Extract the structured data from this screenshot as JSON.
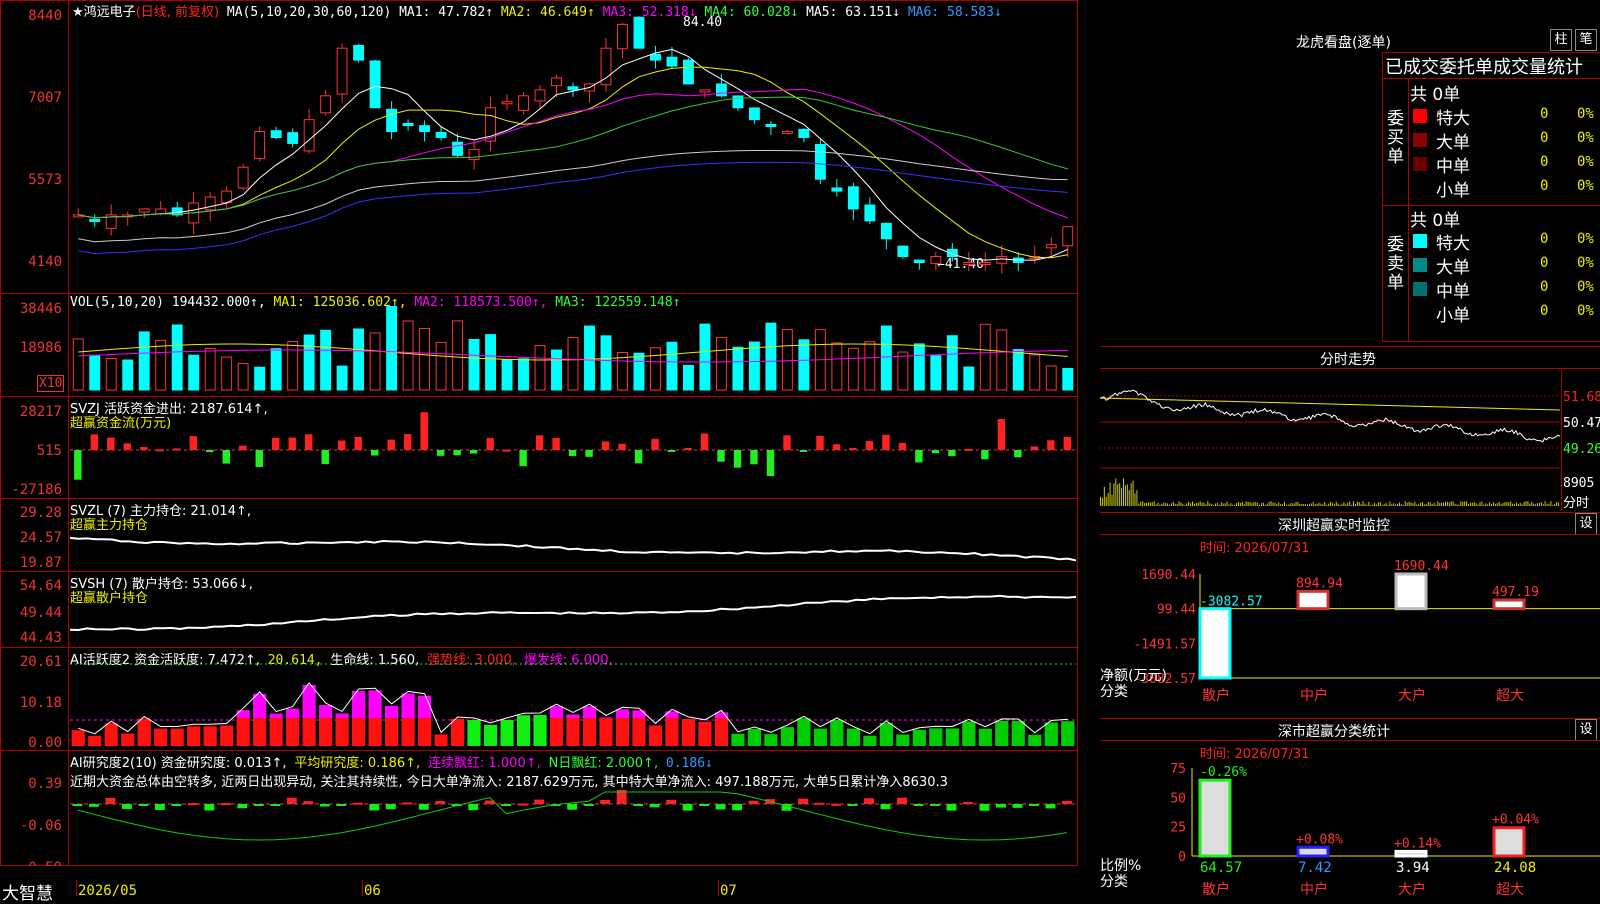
{
  "header": {
    "stock": "★鸿远电子",
    "mode": "(日线, 前复权)",
    "ma_label": "MA(5,10,20,30,60,120)",
    "ma1": "MA1: 47.782↑",
    "ma2": "MA2: 46.649↑",
    "ma3": "MA3: 52.318↓",
    "ma4": "MA4: 60.028↓",
    "ma5": "MA5: 63.151↓",
    "ma6": "MA6: 58.583↓",
    "high_mark": "84.40",
    "low_mark": "←41.40"
  },
  "price_axis": [
    "8440",
    "7007",
    "5573",
    "4140"
  ],
  "vol": {
    "header": "VOL(5,10,20) 194432.000↑,",
    "ma1": "MA1: 125036.602↑,",
    "ma2": "MA2: 118573.500↑,",
    "ma3": "MA3: 122559.148↑",
    "axis": [
      "38446",
      "18986"
    ],
    "unit": "X10"
  },
  "svzj": {
    "header": "SVZJ  活跃资金进出: 2187.614↑,",
    "sub": "超赢资金流(万元)",
    "axis": [
      "28217",
      "515",
      "-27186"
    ]
  },
  "svzl": {
    "header": "SVZL (7) 主力持仓: 21.014↑,",
    "sub": "超赢主力持仓",
    "axis": [
      "29.28",
      "24.57",
      "19.87"
    ]
  },
  "svsh": {
    "header": "SVSH (7) 散户持仓: 53.066↓,",
    "sub": "超赢散户持仓",
    "axis": [
      "54.64",
      "49.44",
      "44.43"
    ]
  },
  "ai1": {
    "header": "AI活跃度2 资金活跃度: 7.472↑,",
    "v2": "20.614,",
    "v3": "生命线: 1.560,",
    "v4": "强势线: 3.000,",
    "v5": "爆发线: 6.000,",
    "axis": [
      "20.61",
      "10.18",
      "0.00"
    ]
  },
  "ai2": {
    "header": "AI研究度2(10) 资金研究度: 0.013↑,",
    "v2": "平均研究度: 0.186↑,",
    "v3": "连续飘红: 1.000↑,",
    "v4": "N日飘红: 2.000↑,",
    "v5": "0.186↓",
    "comment": "近期大资金总体由空转多, 近两日出现异动, 关注其持续性, 今日大单净流入: 2187.629万元, 其中特大单净流入: 497.188万元, 大单5日累计净入8630.3",
    "axis": [
      "0.39",
      "-0.06",
      "-0.50"
    ]
  },
  "bottom": {
    "app": "大智慧",
    "dates": [
      "2026/05",
      "06",
      "07"
    ]
  },
  "right": {
    "lhb_title": "龙虎看盘(逐单)",
    "btn1": "柱",
    "btn2": "笔",
    "section_title": "已成交委托单成交量统计",
    "buy_label": "委买单",
    "sell_label": "委卖单",
    "buy_total": "共 0单",
    "sell_total": "共 0单",
    "rows": [
      {
        "name": "特大",
        "v": "0",
        "p": "0%"
      },
      {
        "name": "大单",
        "v": "0",
        "p": "0%"
      },
      {
        "name": "中单",
        "v": "0",
        "p": "0%"
      },
      {
        "name": "小单",
        "v": "0",
        "p": "0%"
      }
    ],
    "buy_colors": [
      "#ff0000",
      "#8b0000",
      "#6a0000",
      ""
    ],
    "sell_colors": [
      "#00ffff",
      "#008b8b",
      "#007070",
      ""
    ],
    "intraday_title": "分时走势",
    "intraday_axis": [
      "51.68",
      "50.47",
      "49.26"
    ],
    "intraday_vol": "8905",
    "intraday_vol_label": "分时",
    "sz_title": "深圳超赢实时监控",
    "sz_btn": "设",
    "sz_time": "时间: 2026/07/31",
    "sz_axis": [
      "1690.44",
      "99.44",
      "-1491.57",
      "-3082.57"
    ],
    "sz_ylabel": "净额(万元)",
    "sz_xlabel": "分类",
    "sz_values": [
      "-3082.57",
      "894.94",
      "1690.44",
      "497.19"
    ],
    "cats": [
      "散户",
      "中户",
      "大户",
      "超大"
    ],
    "cls_title": "深市超赢分类统计",
    "cls_btn": "设",
    "cls_time": "时间: 2026/07/31",
    "cls_axis": [
      "75",
      "50",
      "25",
      "0"
    ],
    "cls_ylabel": "比例%",
    "cls_xlabel": "分类",
    "cls_top": [
      "-0.26%",
      "+0.08%",
      "+0.14%",
      "+0.04%"
    ],
    "cls_values": [
      "64.57",
      "7.42",
      "3.94",
      "24.08"
    ]
  },
  "chart_data": {
    "type": "bar",
    "title": "深圳超赢实时监控",
    "categories": [
      "散户",
      "中户",
      "大户",
      "超大"
    ],
    "series": [
      {
        "name": "净额(万元)",
        "values": [
          -3082.57,
          894.94,
          1690.44,
          497.19
        ]
      }
    ],
    "ylim": [
      -3082.57,
      1690.44
    ],
    "secondary": {
      "title": "深市超赢分类统计",
      "categories": [
        "散户",
        "中户",
        "大户",
        "超大"
      ],
      "values": [
        64.57,
        7.42,
        3.94,
        24.08
      ],
      "change": [
        "-0.26%",
        "+0.08%",
        "+0.14%",
        "+0.04%"
      ],
      "ylim": [
        0,
        75
      ]
    },
    "price_ylim": [
      41.4,
      84.4
    ]
  }
}
